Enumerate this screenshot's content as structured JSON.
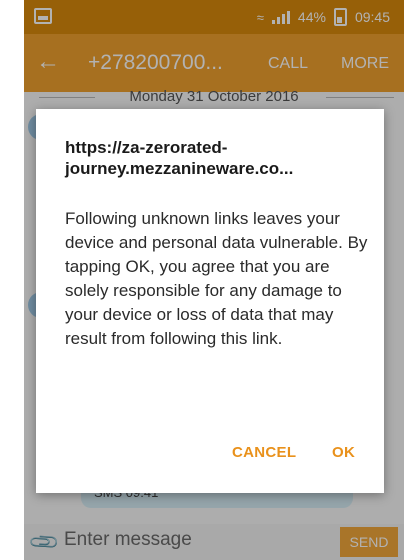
{
  "status_bar": {
    "battery_percent": "44%",
    "time": "09:45",
    "icons": [
      "screenshot-icon",
      "wifi-icon",
      "signal-icon",
      "battery-icon"
    ]
  },
  "app_bar": {
    "back_icon": "arrow-left-icon",
    "title": "+278200700...",
    "call_label": "CALL",
    "more_label": "MORE"
  },
  "conversation": {
    "date_separator": "Monday 31 October 2016",
    "message_time": "SMS 09:41"
  },
  "composer": {
    "attach_icon": "paperclip-icon",
    "placeholder": "Enter message",
    "send_label": "SEND"
  },
  "dialog": {
    "title": "https://za-zerorated-journey.mezzanineware.co...",
    "body": "Following unknown links leaves your device and personal data vulnerable. By tapping OK, you agree that you are solely responsible for any damage to your device or loss of data that may result from following this link.",
    "cancel_label": "CANCEL",
    "ok_label": "OK"
  },
  "colors": {
    "status_bar": "#d98a0c",
    "app_bar": "#f0a12f",
    "accent": "#e9911b",
    "bubble": "#d6edf5"
  }
}
